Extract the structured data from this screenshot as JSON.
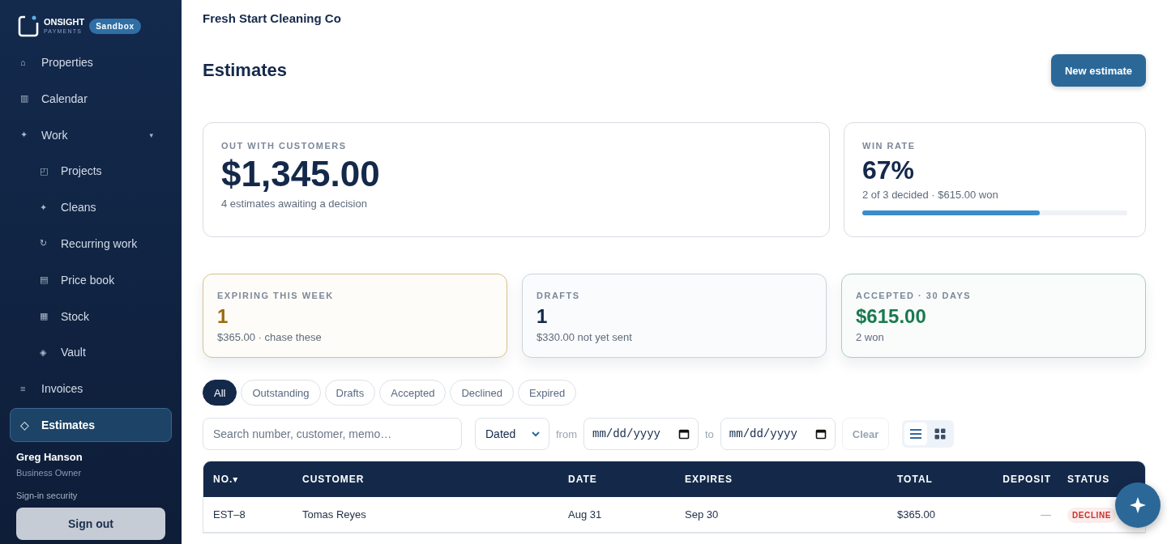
{
  "brand": {
    "name": "ONSIGHT",
    "sub": "PAYMENTS",
    "badge": "Sandbox"
  },
  "sidebar": {
    "items": [
      {
        "icon": "⌂",
        "label": "Properties",
        "selected": false
      },
      {
        "icon": "▥",
        "label": "Calendar",
        "selected": false
      },
      {
        "icon": "✦",
        "label": "Work",
        "selected": false,
        "expanded": true,
        "caret": "▾",
        "children": [
          {
            "icon": "◰",
            "label": "Projects",
            "selected": false
          },
          {
            "icon": "✦",
            "label": "Cleans",
            "selected": false
          },
          {
            "icon": "↻",
            "label": "Recurring work",
            "selected": false
          },
          {
            "icon": "▤",
            "label": "Price book",
            "selected": false
          },
          {
            "icon": "▦",
            "label": "Stock",
            "selected": false
          },
          {
            "icon": "◈",
            "label": "Vault",
            "selected": false
          }
        ]
      },
      {
        "icon": "≡",
        "label": "Invoices",
        "selected": false
      },
      {
        "icon": "◇",
        "label": "Estimates",
        "selected": true
      }
    ],
    "user": {
      "name": "Greg Hanson",
      "role": "Business Owner",
      "security": "Sign-in security",
      "sign_out": "Sign out"
    }
  },
  "company": "Fresh Start Cleaning Co",
  "page_title": "Estimates",
  "new_button": "New estimate",
  "summary": {
    "out": {
      "label": "OUT WITH CUSTOMERS",
      "value": "$1,345.00",
      "note": "4 estimates awaiting a decision"
    },
    "win": {
      "label": "WIN RATE",
      "value": "67%",
      "note": "2 of 3 decided · $615.00 won",
      "level": 0.67
    }
  },
  "cards": [
    {
      "kind": "warning",
      "label": "EXPIRING THIS WEEK",
      "value": "1",
      "note": "$365.00 · chase these"
    },
    {
      "kind": "neutral",
      "label": "DRAFTS",
      "value": "1",
      "note": "$330.00 not yet sent"
    },
    {
      "kind": "success",
      "label": "ACCEPTED · 30 DAYS",
      "value": "$615.00",
      "note": "2 won"
    }
  ],
  "tabs": [
    {
      "label": "All",
      "selected": true
    },
    {
      "label": "Outstanding",
      "selected": false
    },
    {
      "label": "Drafts",
      "selected": false
    },
    {
      "label": "Accepted",
      "selected": false
    },
    {
      "label": "Declined",
      "selected": false
    },
    {
      "label": "Expired",
      "selected": false
    }
  ],
  "filters": {
    "search_placeholder": "Search number, customer, memo…",
    "date_mode": "Dated",
    "from_label": "from",
    "from": "mm/dd/yyyy",
    "to_label": "to",
    "to": "mm/dd/yyyy",
    "clear": "Clear",
    "view": [
      {
        "kind": "list",
        "selected": true
      },
      {
        "kind": "grid",
        "selected": false
      }
    ]
  },
  "table": {
    "columns": [
      {
        "label": "NO.",
        "sort": "▾"
      },
      {
        "label": "CUSTOMER"
      },
      {
        "label": "DATE"
      },
      {
        "label": "EXPIRES"
      },
      {
        "label": "TOTAL"
      },
      {
        "label": "DEPOSIT"
      },
      {
        "label": "STATUS"
      }
    ],
    "rows": [
      {
        "number": "EST–8",
        "customer": "Tomas Reyes",
        "date": "Aug 31",
        "expires": "Sep 30",
        "total": "$365.00",
        "deposit": "—",
        "status": "DECLINE"
      }
    ]
  }
}
